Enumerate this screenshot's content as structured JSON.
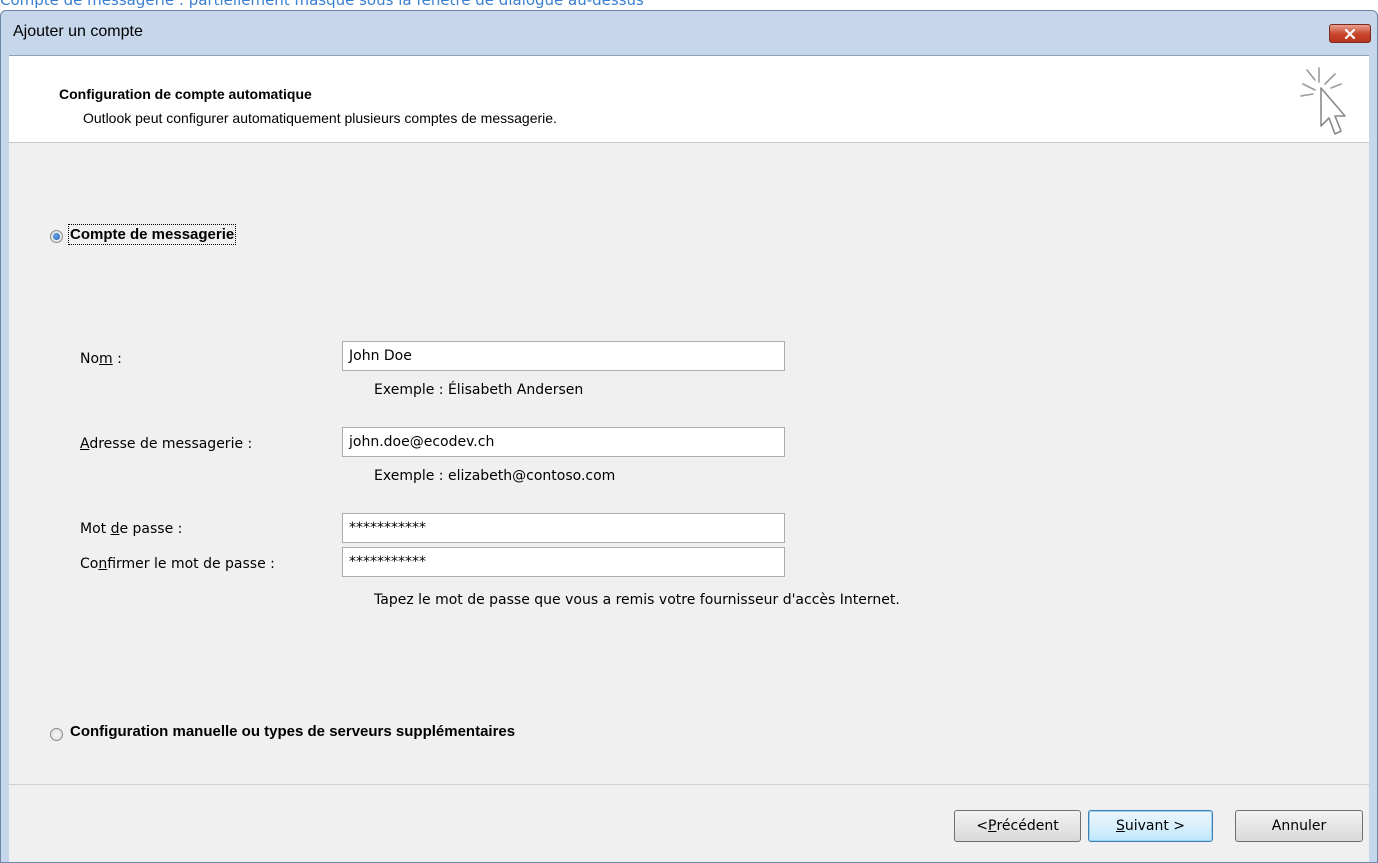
{
  "background": {
    "text": "Compte de messagerie : partiellement masqué sous la fenêtre de dialogue au-dessus"
  },
  "window": {
    "title": "Ajouter un compte"
  },
  "header": {
    "title": "Configuration de compte automatique",
    "subtitle": "Outlook peut configurer automatiquement plusieurs comptes de messagerie."
  },
  "options": {
    "email_account": {
      "label": "Compte de messagerie",
      "checked": true
    },
    "manual_config": {
      "label": "Configuration manuelle ou types de serveurs supplémentaires",
      "checked": false
    }
  },
  "form": {
    "name": {
      "label_pre": "No",
      "label_u": "m",
      "label_post": " :",
      "value": "John Doe",
      "hint": "Exemple : Élisabeth Andersen"
    },
    "email": {
      "label_pre": "",
      "label_u": "A",
      "label_post": "dresse de messagerie :",
      "value": "john.doe@ecodev.ch",
      "hint": "Exemple : elizabeth@contoso.com"
    },
    "password": {
      "label_pre": "Mot ",
      "label_u": "d",
      "label_post": "e passe :",
      "value": "***********"
    },
    "confirm_password": {
      "label_pre": "Co",
      "label_u": "n",
      "label_post": "firmer le mot de passe :",
      "value": "***********"
    },
    "password_hint": "Tapez le mot de passe que vous a remis votre fournisseur d'accès Internet."
  },
  "buttons": {
    "back": {
      "pre": "< ",
      "u": "P",
      "post": "récédent"
    },
    "next": {
      "pre": "",
      "u": "S",
      "post": "uivant >"
    },
    "cancel": {
      "label": "Annuler"
    }
  },
  "colors": {
    "accent": "#3c7fb1",
    "close_button": "#c7432a",
    "title_bar": "#c6d7ec"
  }
}
